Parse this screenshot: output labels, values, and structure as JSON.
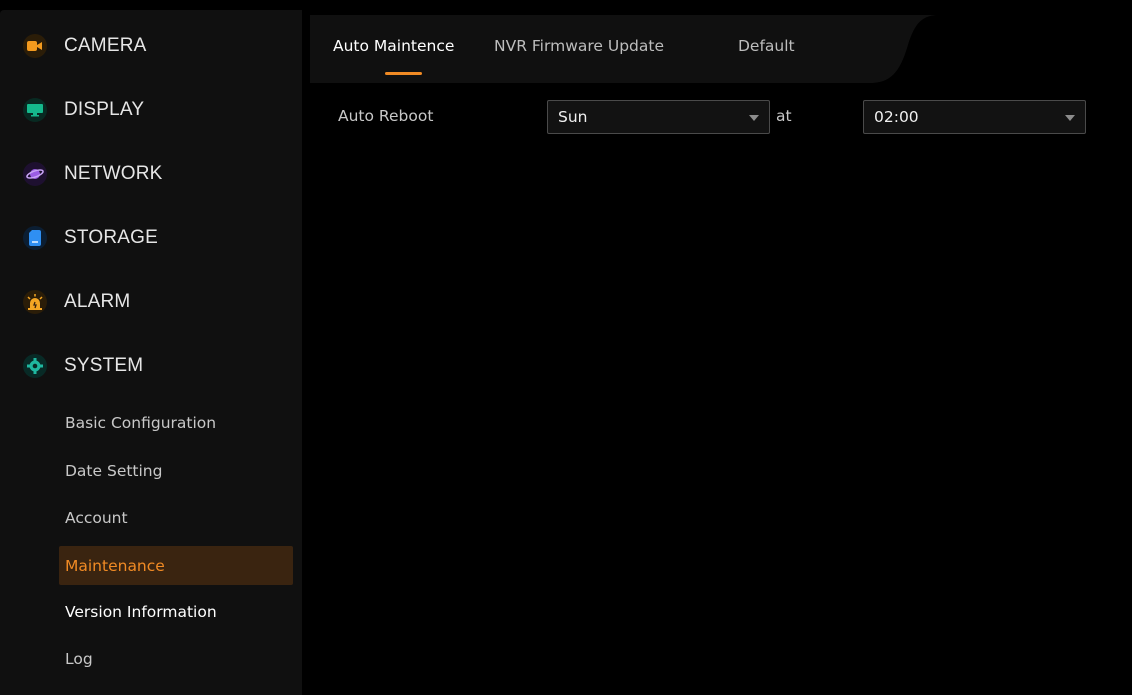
{
  "sidebar": {
    "items": [
      {
        "label": "CAMERA",
        "icon": "camera-icon",
        "color": "#f39a1e"
      },
      {
        "label": "DISPLAY",
        "icon": "display-icon",
        "color": "#15b98c"
      },
      {
        "label": "NETWORK",
        "icon": "network-icon",
        "color": "#9b5de5"
      },
      {
        "label": "STORAGE",
        "icon": "storage-icon",
        "color": "#2f8ff2"
      },
      {
        "label": "ALARM",
        "icon": "alarm-icon",
        "color": "#f5a623"
      },
      {
        "label": "SYSTEM",
        "icon": "system-icon",
        "color": "#1fb7a0"
      }
    ],
    "sub_items": [
      {
        "label": "Basic Configuration"
      },
      {
        "label": "Date Setting"
      },
      {
        "label": "Account"
      },
      {
        "label": "Maintenance"
      },
      {
        "label": "Version Information"
      },
      {
        "label": "Log"
      }
    ],
    "active_sub": "Maintenance"
  },
  "tabs": [
    {
      "label": "Auto Maintence"
    },
    {
      "label": "NVR Firmware Update"
    },
    {
      "label": "Default"
    }
  ],
  "active_tab": "Auto Maintence",
  "form": {
    "auto_reboot_label": "Auto Reboot",
    "day_value": "Sun",
    "at_label": "at",
    "time_value": "02:00"
  },
  "colors": {
    "accent": "#f08a24",
    "active_bg": "#3a2410"
  }
}
